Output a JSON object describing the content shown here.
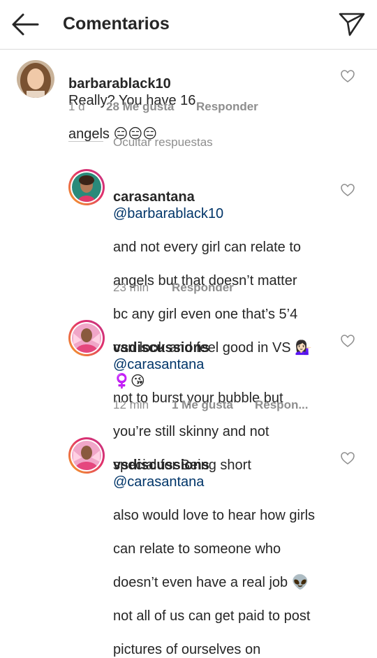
{
  "header": {
    "title": "Comentarios",
    "back_icon": "arrow-left-icon",
    "send_icon": "paper-plane-icon"
  },
  "comments": [
    {
      "username": "barbarablack10",
      "text": "Really? You have 16",
      "text2": "angels 😑😑😑",
      "time": "1 d",
      "likes": "28 Me gusta",
      "reply": "Responder"
    }
  ],
  "hide_replies": "Ocultar respuestas",
  "replies": [
    {
      "username": "carasantana",
      "mention": "@barbarablack10",
      "lines": [
        "and not every girl can relate to",
        "angels but that doesn’t matter",
        "bc any girl even one that’s 5’4",
        "can look and feel good in VS 💁🏻‍♀️",
        "♀️😘"
      ],
      "time": "23 min",
      "reply": "Responder"
    },
    {
      "username": "vsdiscussions",
      "mention": "@carasantana",
      "lines": [
        "not to burst your bubble but",
        "you’re still skinny and not",
        "special for Being short"
      ],
      "time": "12 min",
      "likes": "1 Me gusta",
      "reply": "Respon..."
    },
    {
      "username": "vsdiscussions",
      "mention": "@carasantana",
      "lines": [
        "also would love to hear how girls",
        "can relate to someone who",
        "doesn’t even have a real job 👽",
        "not all of us can get paid to post",
        "pictures of ourselves on"
      ]
    }
  ]
}
